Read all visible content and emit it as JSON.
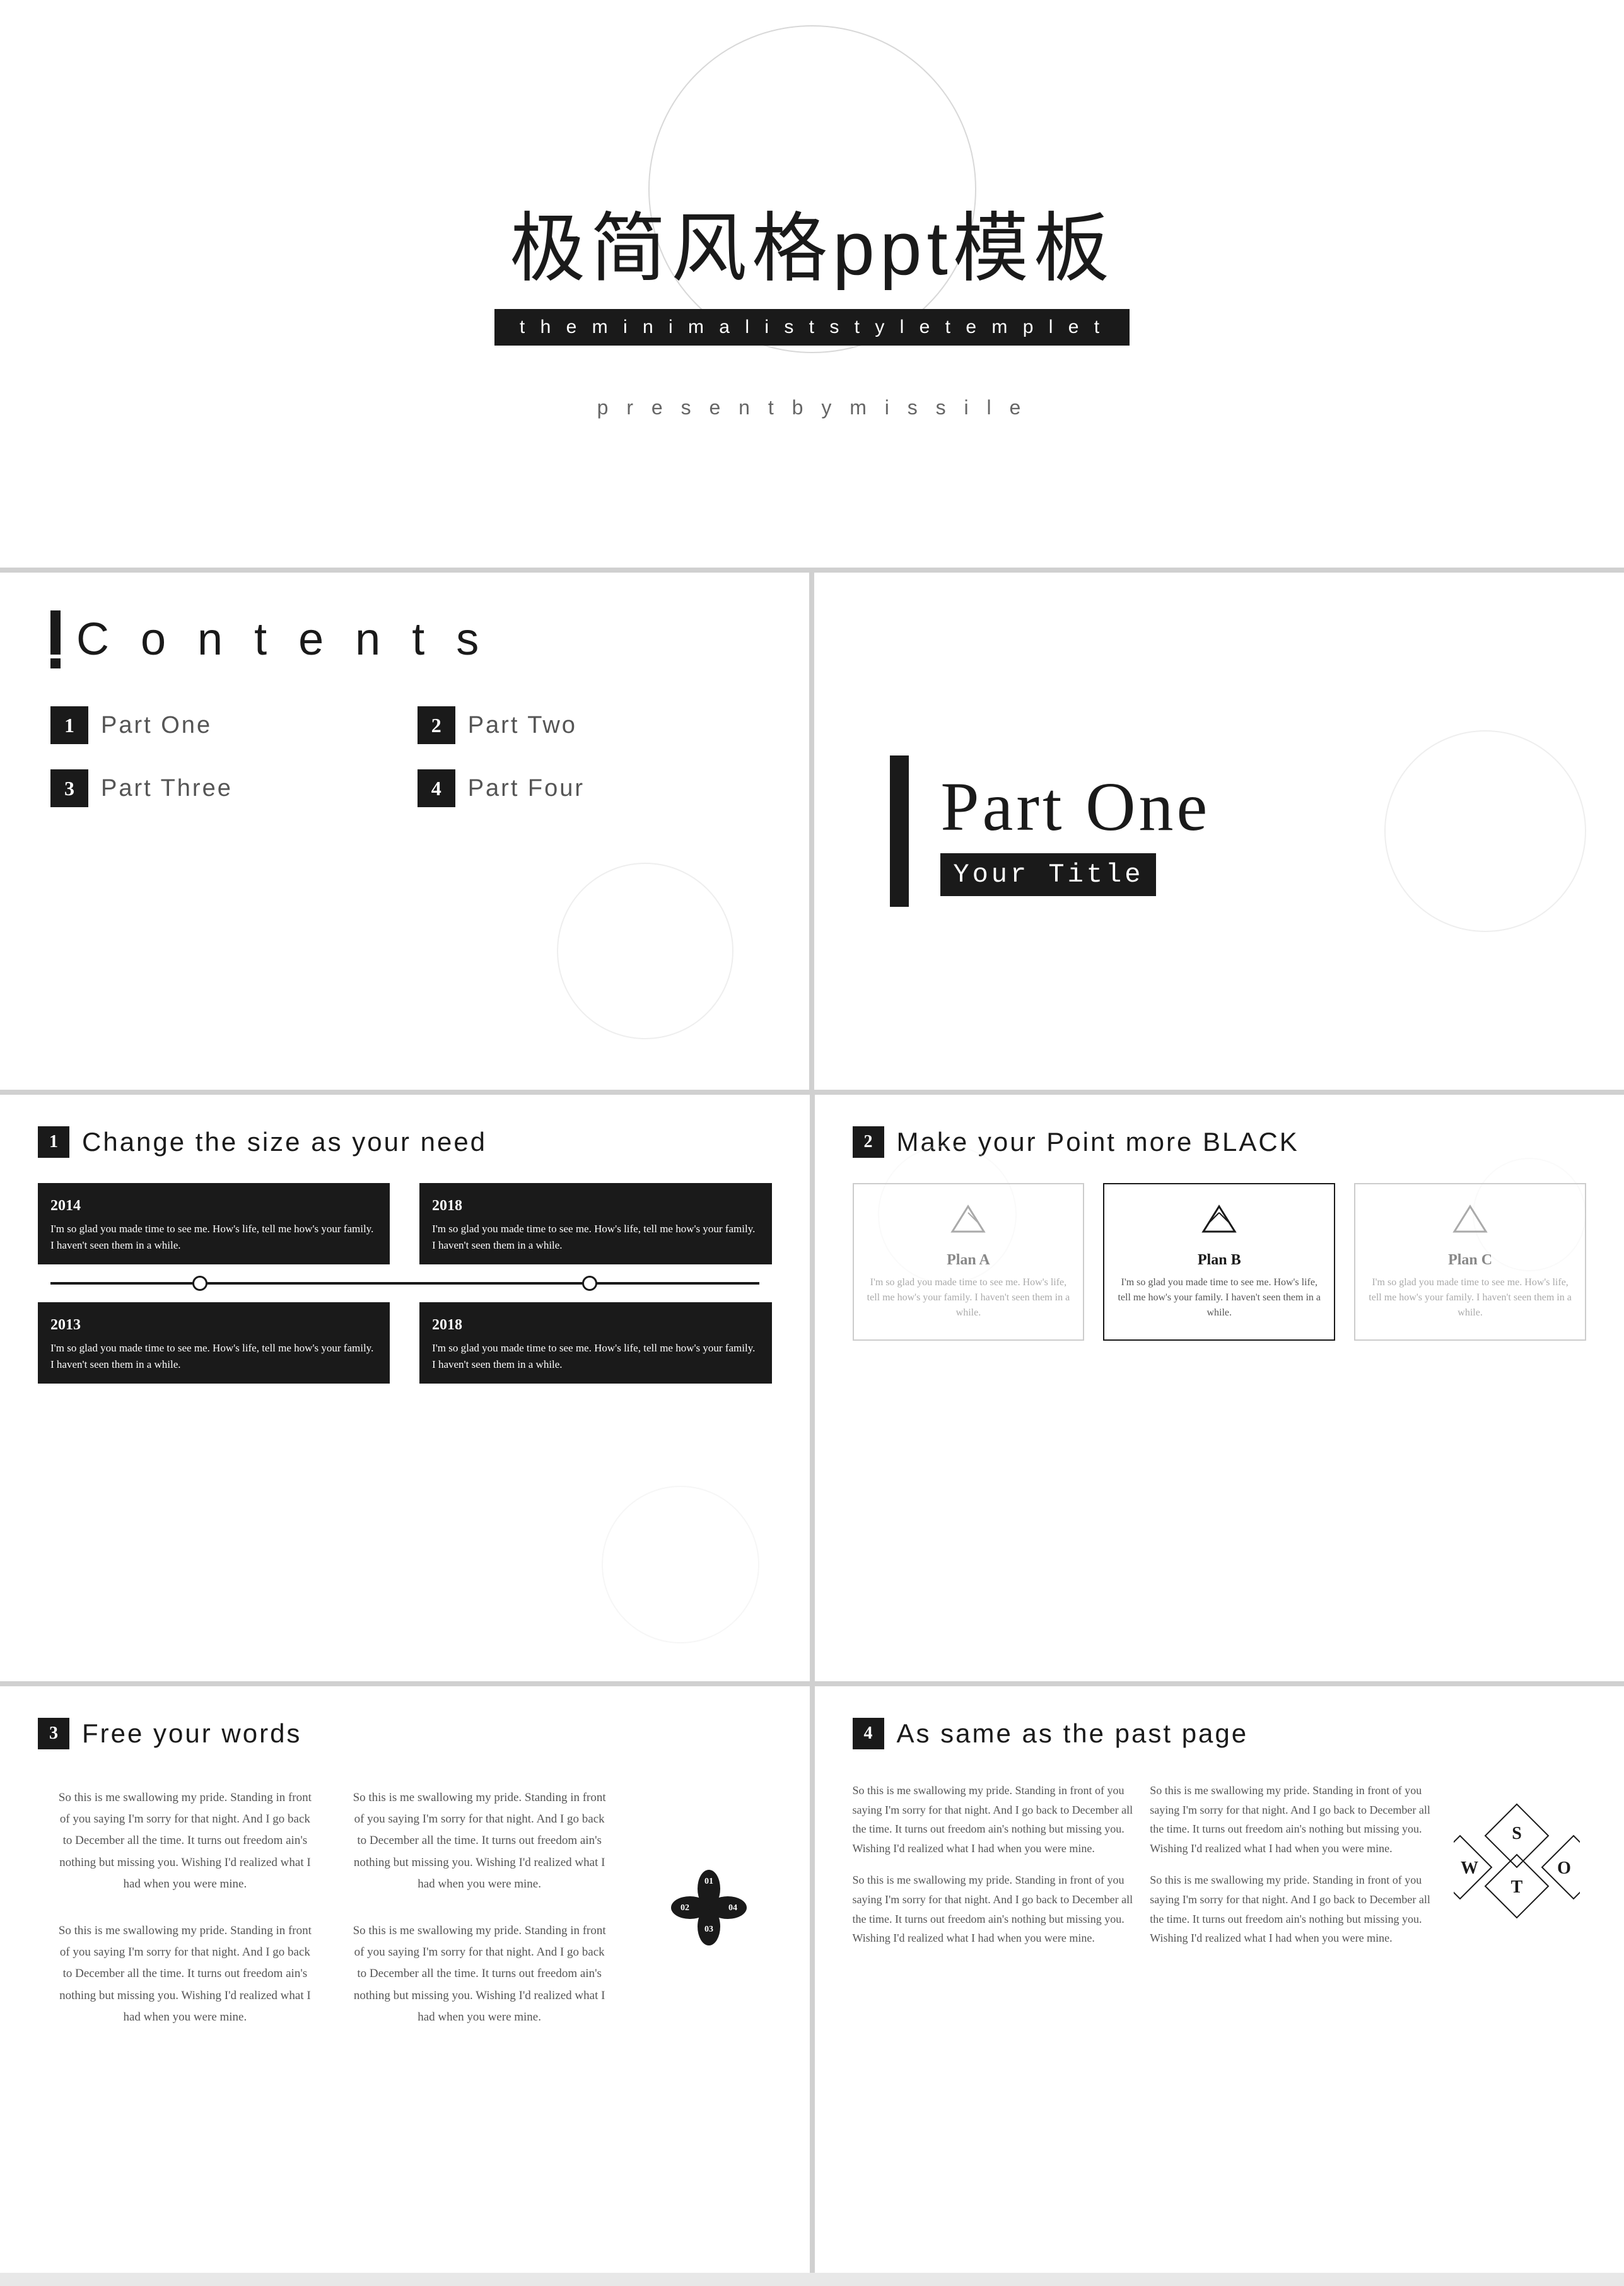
{
  "slide1": {
    "title_cn": "极简风格ppt模板",
    "title_en": "t h e   m i n i m a l i s t   s t y l e   t e m p l e t",
    "present": "p r e s e n t   b y   m i s s i l e"
  },
  "slide2": {
    "contents_label": "C o n t e n t s",
    "items": [
      {
        "num": "1",
        "label": "Part One"
      },
      {
        "num": "2",
        "label": "Part Two"
      },
      {
        "num": "3",
        "label": "Part Three"
      },
      {
        "num": "4",
        "label": "Part Four"
      }
    ]
  },
  "slide3": {
    "part_title": "Part One",
    "part_subtitle": "Your Title"
  },
  "slide4": {
    "section_num": "1",
    "section_title": "Change the size as your need",
    "timeline": [
      {
        "year": "2014",
        "text": "I'm so glad you made time to see me. How's life, tell me how's your family. I haven't seen them in a while."
      },
      {
        "year": "2018",
        "text": "I'm so glad you made time to see me. How's life, tell me how's your family. I haven't seen them in a while."
      }
    ],
    "timeline_bottom": [
      {
        "year": "2013",
        "text": "I'm so glad you made time to see me. How's life, tell me how's your family. I haven't seen them in a while."
      },
      {
        "year": "2018",
        "text": "I'm so glad you made time to see me. How's life, tell me how's your family. I haven't seen them in a while."
      }
    ]
  },
  "slide5": {
    "section_num": "2",
    "section_title": "Make your Point more BLACK",
    "plans": [
      {
        "name": "Plan A",
        "text": "I'm so glad you made time to see me. How's life, tell me how's your family. I haven't seen them in a while."
      },
      {
        "name": "Plan B",
        "text": "I'm so glad you made time to see me. How's life, tell me how's your family. I haven't seen them in a while."
      },
      {
        "name": "Plan C",
        "text": "I'm so glad you made time to see me. How's life, tell me how's your family. I haven't seen them in a while."
      }
    ]
  },
  "slide6": {
    "section_num": "3",
    "section_title": "Free your words",
    "texts": [
      "So this is me swallowing my pride. Standing in front of you saying I'm sorry for that night. And I go back to December all the time. It turns out freedom ain's nothing but missing you. Wishing I'd realized what I had when you were mine.",
      "So this is me swallowing my pride. Standing in front of you saying I'm sorry for that night. And I go back to December all the time. It turns out freedom ain's nothing but missing you. Wishing I'd realized what I had when you were mine.",
      "So this is me swallowing my pride. Standing in front of you saying I'm sorry for that night. And I go back to December all the time. It turns out freedom ain's nothing but missing you. Wishing I'd realized what I had when you were mine.",
      "So this is me swallowing my pride. Standing in front of you saying I'm sorry for that night. And I go back to December all the time. It turns out freedom ain's nothing but missing you. Wishing I'd realized what I had when you were mine."
    ],
    "nums": [
      "01",
      "02",
      "03",
      "04"
    ]
  },
  "slide7": {
    "section_num": "4",
    "section_title": "As same as the past page",
    "texts": [
      "So this is me swallowing my pride. Standing in front of you saying I'm sorry for that night. And I go back to December all the time. It turns out freedom ain's nothing but missing you. Wishing I'd realized what I had when you were mine.",
      "So this is me swallowing my pride. Standing in front of you saying I'm sorry for that night. And I go back to December all the time. It turns out freedom ain's nothing but missing you. Wishing I'd realized what I had when you were mine.",
      "So this is me swallowing my pride. Standing in front of you saying I'm sorry for that night. And I go back to December all the time. It turns out freedom ain's nothing but missing you. Wishing I'd realized what I had when you were mine.",
      "So this is me swallowing my pride. Standing in front of you saying I'm sorry for that night. And I go back to December all the time. It turns out freedom ain's nothing but missing you. Wishing I'd realized what I had when you were mine."
    ],
    "swot": [
      "S",
      "W",
      "T",
      "O"
    ]
  }
}
